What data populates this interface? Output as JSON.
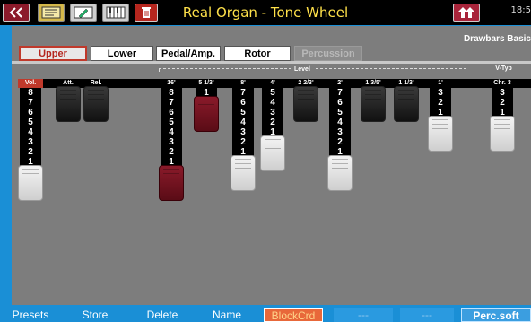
{
  "title": "Real Organ - Tone Wheel",
  "clock": "18:5",
  "preset_name": "Drawbars Basic",
  "tabs": [
    {
      "label": "Upper",
      "state": "active"
    },
    {
      "label": "Lower",
      "state": "normal"
    },
    {
      "label": "Pedal/Amp.",
      "state": "normal"
    },
    {
      "label": "Rotor",
      "state": "normal"
    },
    {
      "label": "Percussion",
      "state": "disabled"
    }
  ],
  "level_label": "Level",
  "vtyp_label": "V-Typ",
  "columns": [
    {
      "label": "Vol.",
      "value": 8,
      "color": "white",
      "highlight": true
    },
    {
      "label": "Att.",
      "value": 0,
      "color": "black"
    },
    {
      "label": "Rel.",
      "value": 0,
      "color": "black"
    },
    {
      "label": "16'",
      "value": 8,
      "color": "maroon"
    },
    {
      "label": "5 1/3'",
      "value": 1,
      "color": "maroon"
    },
    {
      "label": "8'",
      "value": 7,
      "color": "white"
    },
    {
      "label": "4'",
      "value": 5,
      "color": "white"
    },
    {
      "label": "2 2/3'",
      "value": 0,
      "color": "black"
    },
    {
      "label": "2'",
      "value": 7,
      "color": "white"
    },
    {
      "label": "1 3/5'",
      "value": 0,
      "color": "black"
    },
    {
      "label": "1 1/3'",
      "value": 0,
      "color": "black"
    },
    {
      "label": "1'",
      "value": 3,
      "color": "white"
    },
    {
      "label": "Chr. 3",
      "value": 3,
      "color": "white"
    }
  ],
  "function_keys": [
    {
      "label": "Presets",
      "state": "normal"
    },
    {
      "label": "Store",
      "state": "normal"
    },
    {
      "label": "Delete",
      "state": "normal"
    },
    {
      "label": "Name",
      "state": "normal"
    },
    {
      "label": "BlockCrd",
      "state": "highlight"
    },
    {
      "label": "---",
      "state": "dim"
    },
    {
      "label": "---",
      "state": "dim"
    },
    {
      "label": "Perc.soft",
      "state": "selected"
    }
  ],
  "icons": [
    "back-arrows-icon",
    "midi-icon",
    "edit-icon",
    "keyboard-icon",
    "trash-icon",
    "shift-icon"
  ],
  "colors": {
    "accent": "#1a8fd6",
    "title": "#ffe14a",
    "active_tab": "#c0392b",
    "highlight_key": "#e8683a"
  }
}
